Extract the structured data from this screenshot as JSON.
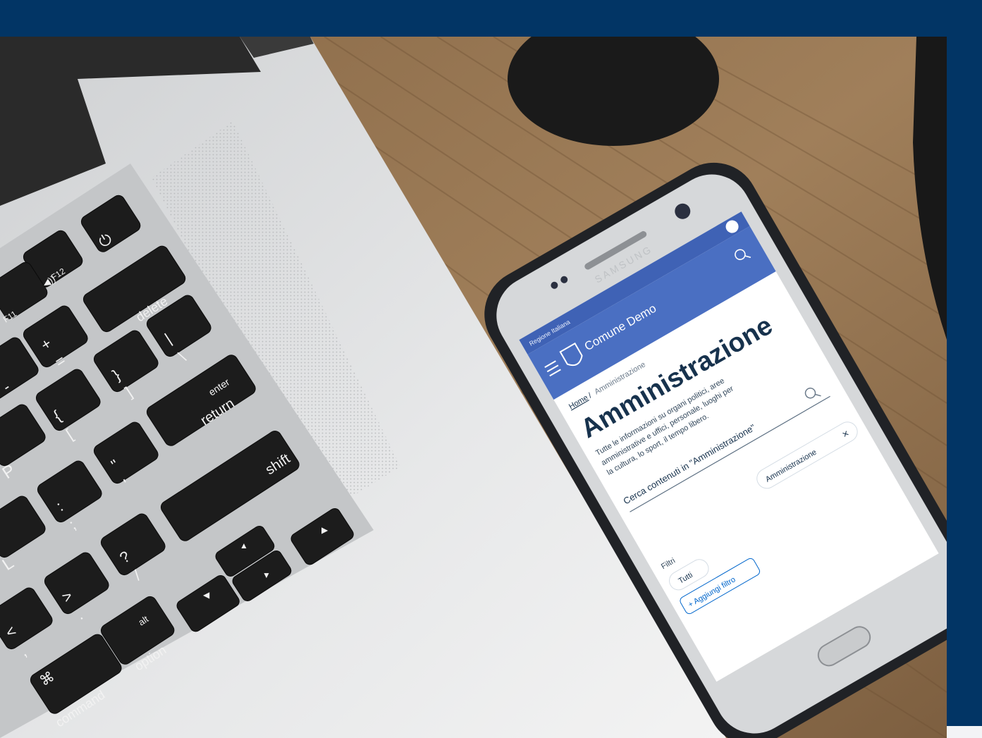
{
  "banner": {
    "background_color": "#023565"
  },
  "phone": {
    "brand": "SAMSUNG",
    "screen": {
      "region_label": "Regione Italiana",
      "site_name": "Comune Demo",
      "breadcrumb_home": "Home",
      "breadcrumb_separator": "/",
      "breadcrumb_current": "Amministrazione",
      "title": "Amministrazione",
      "description_lines": [
        "Tutte le informazioni su organi politici, aree",
        "amministrative e uffici, personale, luoghi per",
        "la cultura, lo sport, il tempo libero."
      ],
      "search_placeholder": "Cerca contenuti in \"Amministrazione\"",
      "chip_label": "Amministrazione",
      "chip_close": "×",
      "filters_label": "Filtri",
      "filter_all": "Tutti",
      "add_filter": "+ Aggiungi filtro",
      "header_color": "#4a6fc2",
      "accent_color": "#0066cc"
    }
  },
  "keyboard": {
    "keys": {
      "f11": "F11",
      "f12": "F12",
      "delete": "delete",
      "plus": "+",
      "equals": "=",
      "minus": "-",
      "brace_close": "}",
      "bracket_close": "]",
      "pipe": "|",
      "backslash": "\\",
      "enter": "enter",
      "return": "return",
      "brace_open": "{",
      "bracket_open": "[",
      "quote_double": "\"",
      "quote_single": "'",
      "p": "P",
      "colon": ":",
      "semicolon": ";",
      "shift": "shift",
      "l": "L",
      "question": "?",
      "slash": "/",
      "greater": ">",
      "period": ".",
      "less": "<",
      "comma": ",",
      "alt": "alt",
      "option": "option",
      "cmd_symbol": "⌘",
      "command": "command",
      "arrow_up": "▲",
      "arrow_down": "▼",
      "arrow_left": "◀",
      "arrow_right": "▶"
    }
  }
}
